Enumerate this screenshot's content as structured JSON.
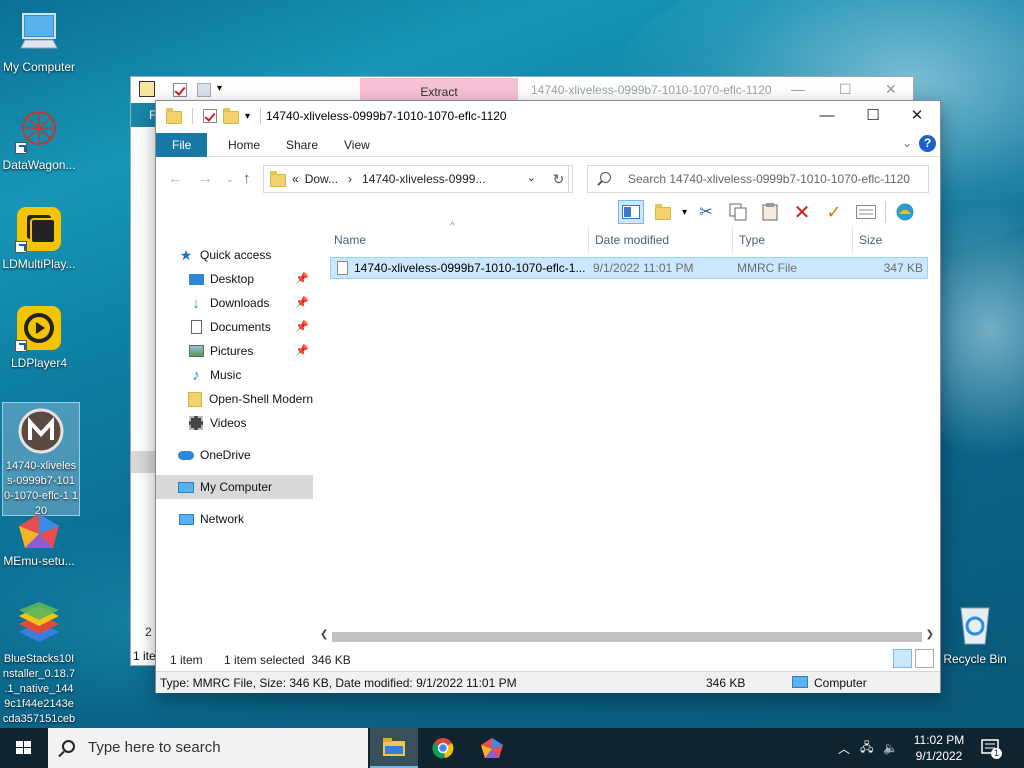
{
  "desktop": {
    "icons": [
      {
        "label": "My Computer"
      },
      {
        "label": "DataWagon..."
      },
      {
        "label": "LDMultiPlay..."
      },
      {
        "label": "LDPlayer4"
      },
      {
        "label": "14740-xliveles s-0999b7-101 0-1070-eflc-1 120"
      },
      {
        "label": "MEmu-setu..."
      },
      {
        "label": "BlueStacks10I nstaller_0.18.7 .1_native_144 9c1f44e2143e cda357151ceb"
      },
      {
        "label": "Recycle Bin"
      }
    ]
  },
  "bg_window": {
    "tab_label": "Extract",
    "title": "14740-xliveless-0999b7-1010-1070-eflc-1120",
    "ribbon_stub": "F",
    "status_count": "2 i",
    "status_item": "1 ite"
  },
  "window": {
    "title": "14740-xliveless-0999b7-1010-1070-eflc-1120",
    "ribbon_tabs": [
      "File",
      "Home",
      "Share",
      "View"
    ],
    "help": "?",
    "address": {
      "prefix": "«",
      "crumb1": "Dow...",
      "sep": "›",
      "crumb2": "14740-xliveless-0999..."
    },
    "search_placeholder": "Search 14740-xliveless-0999b7-1010-1070-eflc-1120",
    "nav": {
      "items": [
        {
          "label": "Quick access"
        },
        {
          "label": "Desktop"
        },
        {
          "label": "Downloads"
        },
        {
          "label": "Documents"
        },
        {
          "label": "Pictures"
        },
        {
          "label": "Music"
        },
        {
          "label": "Open-Shell Modern"
        },
        {
          "label": "Videos"
        },
        {
          "label": "OneDrive"
        },
        {
          "label": "My Computer"
        },
        {
          "label": "Network"
        }
      ]
    },
    "columns": [
      "Name",
      "Date modified",
      "Type",
      "Size"
    ],
    "files": [
      {
        "name": "14740-xliveless-0999b7-1010-1070-eflc-1...",
        "date": "9/1/2022 11:01 PM",
        "type": "MMRC File",
        "size": "347 KB"
      }
    ],
    "status": {
      "count": "1 item",
      "selected": "1 item selected  346 KB"
    },
    "details_bar": {
      "info": "Type: MMRC File, Size: 346 KB, Date modified: 9/1/2022 11:01 PM",
      "size": "346 KB",
      "location": "Computer"
    }
  },
  "taskbar": {
    "search_placeholder": "Type here to search",
    "time": "11:02 PM",
    "date": "9/1/2022",
    "notif_count": "1"
  },
  "colors": {
    "accent": "#1979a6",
    "selection": "#cce8ff",
    "taskbar": "#10242f"
  }
}
